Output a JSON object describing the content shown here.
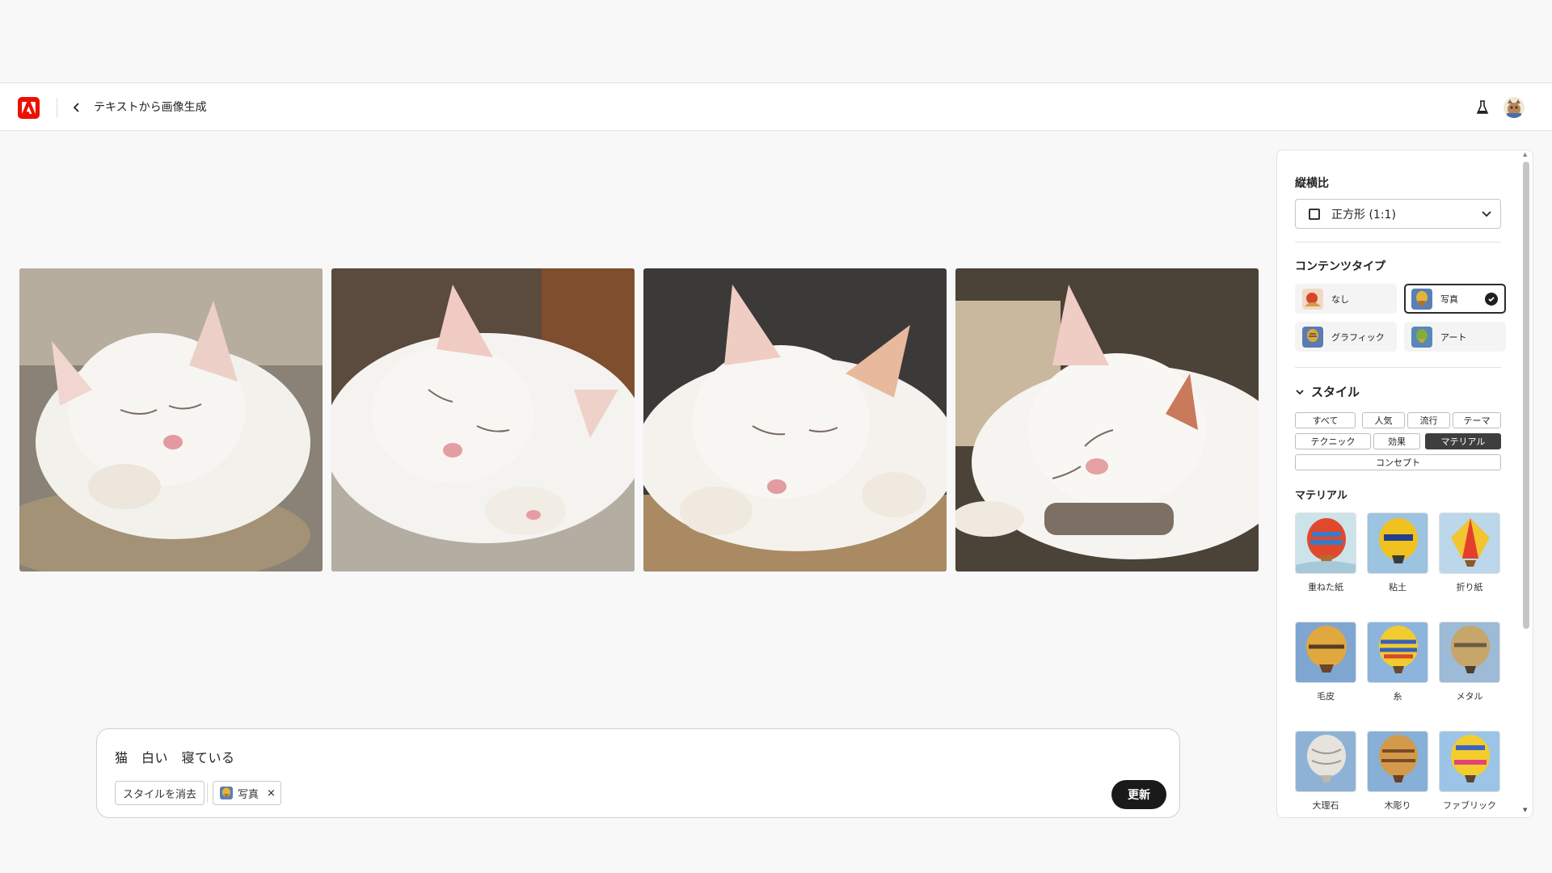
{
  "header": {
    "title": "テキストから画像生成",
    "logo_icon": "adobe-logo-icon",
    "back_icon": "chevron-left-icon",
    "labs_icon": "flask-icon",
    "avatar_icon": "avatar"
  },
  "images": [
    {
      "alt_name": "generated-image-1"
    },
    {
      "alt_name": "generated-image-2"
    },
    {
      "alt_name": "generated-image-3"
    },
    {
      "alt_name": "generated-image-4"
    }
  ],
  "prompt": {
    "text": "猫　白い　寝ている",
    "clear_style_label": "スタイルを消去",
    "style_chip_label": "写真",
    "remove_icon": "×",
    "update_label": "更新"
  },
  "panel": {
    "aspect_ratio": {
      "label": "縦横比",
      "value": "正方形 (1:1)"
    },
    "content_type": {
      "label": "コンテンツタイプ",
      "options": [
        {
          "label": "なし",
          "selected": false
        },
        {
          "label": "写真",
          "selected": true
        },
        {
          "label": "グラフィック",
          "selected": false
        },
        {
          "label": "アート",
          "selected": false
        }
      ]
    },
    "style": {
      "label": "スタイル",
      "tabs": [
        {
          "label": "すべて",
          "active": false
        },
        {
          "label": "人気",
          "active": false
        },
        {
          "label": "流行",
          "active": false
        },
        {
          "label": "テーマ",
          "active": false
        },
        {
          "label": "テクニック",
          "active": false
        },
        {
          "label": "効果",
          "active": false
        },
        {
          "label": "マテリアル",
          "active": true
        },
        {
          "label": "コンセプト",
          "active": false
        }
      ],
      "section_label": "マテリアル",
      "materials": [
        {
          "label": "重ねた紙"
        },
        {
          "label": "粘土"
        },
        {
          "label": "折り紙"
        },
        {
          "label": "毛皮"
        },
        {
          "label": "糸"
        },
        {
          "label": "メタル"
        },
        {
          "label": "大理石"
        },
        {
          "label": "木彫り"
        },
        {
          "label": "ファブリック"
        }
      ]
    }
  },
  "colors": {
    "brand": "#eb1000",
    "button_dark": "#1a1a1a",
    "active_tag": "#3e3e3e"
  }
}
